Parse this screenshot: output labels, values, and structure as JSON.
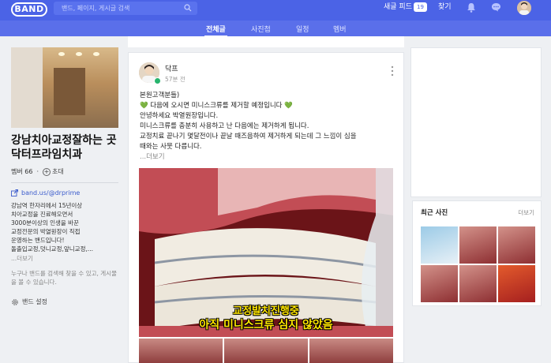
{
  "topbar": {
    "logo": "BAND",
    "search_placeholder": "밴드, 페이지, 게시글 검색",
    "new_feed_label": "새글 피드",
    "new_feed_count": "19",
    "find_label": "찾기"
  },
  "tabs": [
    {
      "label": "전체글",
      "active": true
    },
    {
      "label": "사진첩",
      "active": false
    },
    {
      "label": "일정",
      "active": false
    },
    {
      "label": "멤버",
      "active": false
    }
  ],
  "sidebar": {
    "band_name": "강남치아교정잘하는 곳 닥터프라임치과",
    "members_label": "멤버 66",
    "invite_label": "초대",
    "link": "band.us/@drprime",
    "description": "강남역 한자리에서 15년이상\n치아교정을 진료해오면서\n3000분이상의 인생을 바꾼\n교정전문의 박열원장이 직접\n운영하는 밴드입니다!\n돌출입교정,덧니교정,앞니교정,...",
    "more_label": "...더보기",
    "note": "누구나 밴드를 검색해 찾을 수 있고, 게시물을 볼 수 있습니다.",
    "settings_label": "밴드 설정"
  },
  "post": {
    "author": "닥프",
    "time": "57분 전",
    "lines": [
      "본원고객분들)",
      "다음에 오시면 미니스크류를 제거할 예정입니다",
      "안녕하세요 박열원장입니다.",
      "미니스크류를 충분히 사용하고 난 다음에는 제거하게 됩니다.",
      "교정치료 끝나기 몇달전이나 끝날 때즈음하여 제거하게 되는데 그 느낌이 심을",
      "때와는 사뭇 다릅니다."
    ],
    "heart": "💚",
    "read_more": "...더보기",
    "image_caption_1": "교정발치진행중",
    "image_caption_2": "아직 미니스크류 심지 않았음"
  },
  "recent_photos": {
    "title": "최근 사진",
    "more": "더보기"
  },
  "colors": {
    "brand": "#4b63e6",
    "tabbar": "#5a6fea",
    "badge_green": "#27b46d",
    "caption_yellow": "#ffe600"
  }
}
